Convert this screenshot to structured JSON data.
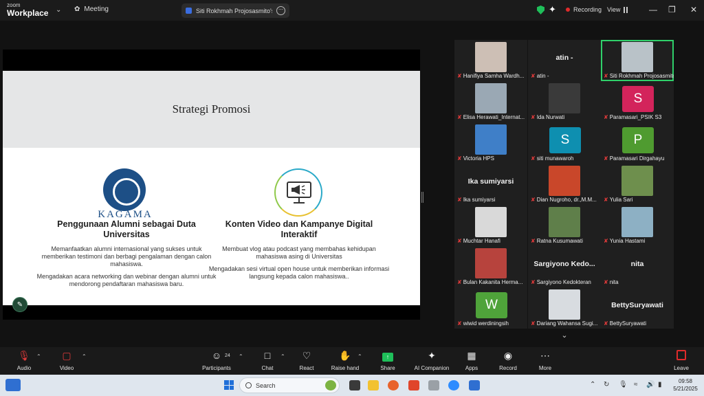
{
  "titlebar": {
    "logo_top": "zoom",
    "logo_bottom": "Workplace",
    "meeting_label": "Meeting",
    "share_title": "Siti Rokhmah Projosasmito's scre",
    "recording_label": "Recording",
    "view_label": "View"
  },
  "slide": {
    "title": "Strategi Promosi",
    "logo_text": "KAGAMA",
    "left": {
      "heading": "Penggunaan Alumni sebagai Duta Universitas",
      "p1": "Memanfaatkan alumni internasional yang sukses untuk memberikan testimoni dan berbagi pengalaman dengan calon mahasiswa.",
      "p2": "Mengadakan acara networking dan webinar dengan alumni untuk mendorong pendaftaran mahasiswa baru."
    },
    "right": {
      "heading": "Konten Video dan Kampanye Digital Interaktif",
      "p1": "Membuat vlog atau podcast yang membahas kehidupan mahasiswa asing di Universitas",
      "p2": "Mengadakan sesi virtual open house untuk memberikan informasi langsung kepada calon mahasiswa.."
    }
  },
  "participants": [
    {
      "name": "Hanifiya Samha Wardh...",
      "kind": "photo",
      "color": "#cdbfb5"
    },
    {
      "name": "atin -",
      "kind": "text",
      "display": "atin -"
    },
    {
      "name": "Siti Rokhmah Projosasmito",
      "kind": "photo",
      "color": "#b9c2c8",
      "active": true
    },
    {
      "name": "Elisa Herawati_Internat...",
      "kind": "photo",
      "color": "#9aa8b4"
    },
    {
      "name": "Ida Nurwati",
      "kind": "photo",
      "color": "#3a3a3a"
    },
    {
      "name": "Paramasari_PSIK S3",
      "kind": "letter",
      "letter": "S",
      "color": "#d3245b"
    },
    {
      "name": "Victoria HPS",
      "kind": "photo",
      "color": "#3f7fc8"
    },
    {
      "name": "siti munawaroh",
      "kind": "letter",
      "letter": "S",
      "color": "#0e8fb0"
    },
    {
      "name": "Paramasari Dirgahayu",
      "kind": "letter",
      "letter": "P",
      "color": "#4f9b30"
    },
    {
      "name": "Ika sumiyarsi",
      "kind": "text",
      "display": "Ika sumiyarsi"
    },
    {
      "name": "Dian Nugroho, dr.,M.M...",
      "kind": "photo",
      "color": "#c9472a"
    },
    {
      "name": "Yulia Sari",
      "kind": "photo",
      "color": "#6e8f4d"
    },
    {
      "name": "Muchtar Hanafi",
      "kind": "photo",
      "color": "#d9d9d9"
    },
    {
      "name": "Ratna Kusumawati",
      "kind": "photo",
      "color": "#5f7f4a"
    },
    {
      "name": "Yunia Hastami",
      "kind": "photo",
      "color": "#8db0c4"
    },
    {
      "name": "Bulan Kakanita Herma...",
      "kind": "photo",
      "color": "#b7433d"
    },
    {
      "name": "Sargiyono Kedokteran",
      "kind": "text",
      "display": "Sargiyono Kedo..."
    },
    {
      "name": "nita",
      "kind": "text",
      "display": "nita"
    },
    {
      "name": "wiwid werdiningsih",
      "kind": "letter",
      "letter": "W",
      "color": "#4fa33a"
    },
    {
      "name": "Dariang Wahansa Sugi...",
      "kind": "photo",
      "color": "#d8dce0"
    },
    {
      "name": "BettySuryawati",
      "kind": "text",
      "display": "BettySuryawati"
    }
  ],
  "toolbar": {
    "audio": "Audio",
    "video": "Video",
    "participants": "Participants",
    "participant_count": "24",
    "chat": "Chat",
    "react": "React",
    "raise_hand": "Raise hand",
    "share": "Share",
    "ai_companion": "AI Companion",
    "apps": "Apps",
    "record": "Record",
    "more": "More",
    "leave": "Leave"
  },
  "taskbar": {
    "search_placeholder": "Search",
    "time": "09:58",
    "date": "5/21/2025"
  }
}
